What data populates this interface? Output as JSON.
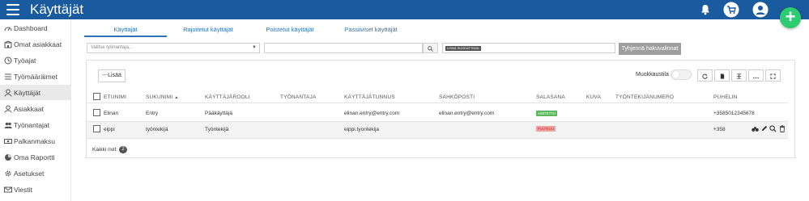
{
  "app": {
    "title": "Käyttäjät"
  },
  "sidebar": {
    "items": [
      {
        "label": "Dashboard",
        "icon": "dashboard-icon"
      },
      {
        "label": "Omat asiakkaat",
        "icon": "building-icon"
      },
      {
        "label": "Työajat",
        "icon": "clock-icon"
      },
      {
        "label": "Työmääräimet",
        "icon": "checklist-icon"
      },
      {
        "label": "Käyttäjät",
        "icon": "user-icon",
        "active": true
      },
      {
        "label": "Asiakkaat",
        "icon": "user-outline-icon"
      },
      {
        "label": "Työnantajat",
        "icon": "users-icon"
      },
      {
        "label": "Palkanmaksu",
        "icon": "money-icon"
      },
      {
        "label": "Oma Raportti",
        "icon": "pie-chart-icon"
      },
      {
        "label": "Asetukset",
        "icon": "gear-icon"
      },
      {
        "label": "Viestit",
        "icon": "mail-icon"
      }
    ]
  },
  "tabs": [
    {
      "label": "Käyttäjät",
      "active": true
    },
    {
      "label": "Rajoitetut käyttäjät"
    },
    {
      "label": "Poistetut käyttäjät"
    },
    {
      "label": "Passiiviset käyttäjät"
    }
  ],
  "filters": {
    "employer_placeholder": "Valitse työnantaja...",
    "search_value": "",
    "tag_chip": "LISÄÄ SUODATTIMIA",
    "clear_label": "Tyhjennä hakuvalinnat"
  },
  "toolbar": {
    "add_label": "Lisää",
    "edit_mode_label": "Muokkaustila"
  },
  "table": {
    "columns": [
      "ETUNIMI",
      "SUKUNIMI",
      "KÄYTTÄJÄROOLI",
      "TYÖNANTAJA",
      "KÄYTTÄJÄTUNNUS",
      "SÄHKÖPOSTI",
      "SALASANA",
      "KUVA",
      "TYÖNTEKIJÄNUMERO",
      "PUHELIN"
    ],
    "sort_indicator": "▲",
    "rows": [
      {
        "etunimi": "Elinan",
        "sukunimi": "Entry",
        "rooli": "Pääkäyttäjä",
        "tyonantaja": "",
        "tunnus": "elinan.entry@entry.com",
        "email": "elinan.entry@entry.com",
        "salasana": "ASETETTU",
        "salasana_status": "set",
        "kuva": "",
        "numero": "",
        "puhelin": "+3585012345678"
      },
      {
        "etunimi": "eippi",
        "sukunimi": "työntekijä",
        "rooli": "Työntekijä",
        "tyonantaja": "",
        "tunnus": "eippi.tyontekija",
        "email": "",
        "salasana": "PUUTTUU",
        "salasana_status": "missing",
        "kuva": "",
        "numero": "",
        "puhelin": "+358"
      }
    ]
  },
  "footer": {
    "label": "Kaikki rivit:",
    "count": "2"
  },
  "colors": {
    "topbar": "#1a5a9e",
    "accent": "#2f72b8",
    "fab": "#2ecc71",
    "badge_set": "#5cb85c",
    "badge_missing": "#f2a0a0"
  }
}
